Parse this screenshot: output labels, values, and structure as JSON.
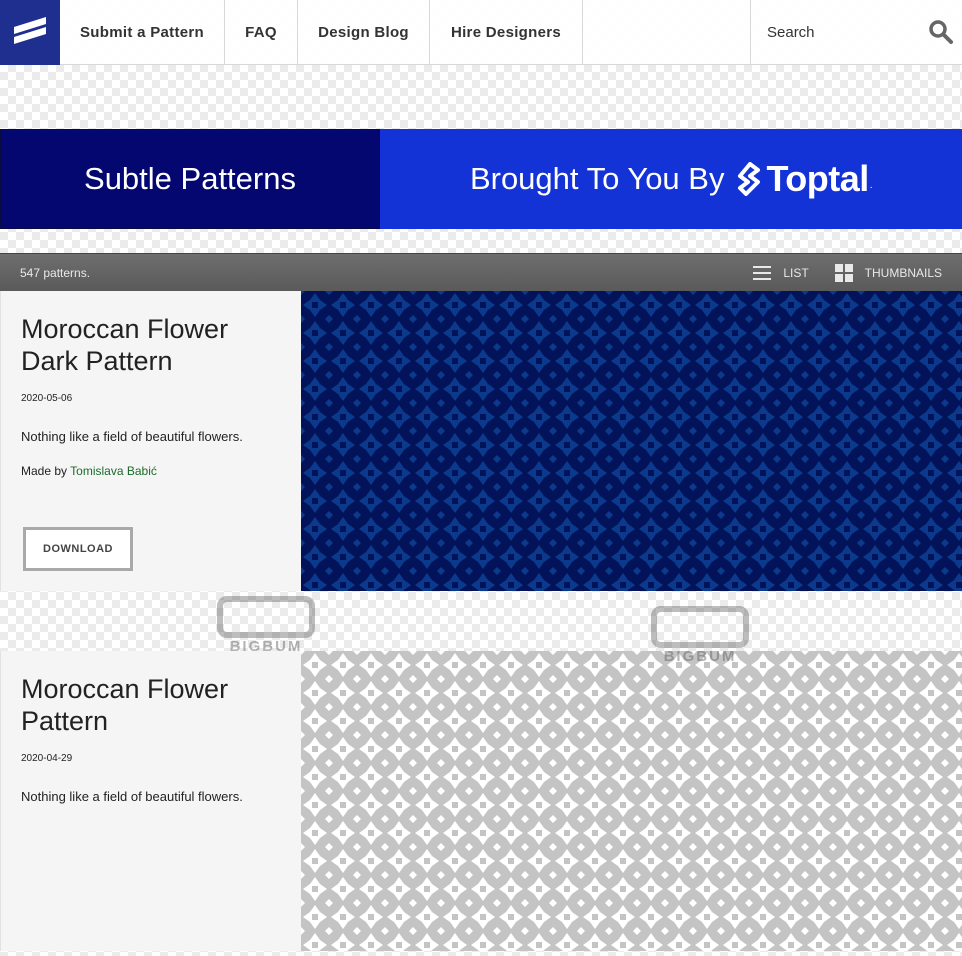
{
  "nav": {
    "items": [
      "Submit a Pattern",
      "FAQ",
      "Design Blog",
      "Hire Designers"
    ],
    "search_placeholder": "Search"
  },
  "banner": {
    "left_text": "Subtle Patterns",
    "right_text": "Brought To You By",
    "brand": "Toptal",
    "brand_mark": "."
  },
  "toolbar": {
    "count": "547 patterns.",
    "list_label": "LIST",
    "thumbnails_label": "THUMBNAILS"
  },
  "patterns": [
    {
      "title": "Moroccan Flower Dark Pattern",
      "date": "2020-05-06",
      "description": "Nothing like a field of beautiful flowers.",
      "made_by_label": "Made by",
      "author": "Tomislava Babić",
      "download_label": "DOWNLOAD"
    },
    {
      "title": "Moroccan Flower Pattern",
      "date": "2020-04-29",
      "description": "Nothing like a field of beautiful flowers."
    }
  ],
  "watermark_text": "BIGBUM",
  "colors": {
    "logo": "#1f2f8f",
    "banner_left": "#03076f",
    "banner_right": "#1433d6",
    "pattern_dark_bg": "#03135a",
    "pattern_dark_fg": "#0b3a8c",
    "pattern_light_bg": "#ffffff",
    "pattern_light_fg": "#c4c4c4",
    "author_link": "#1a6b2a"
  }
}
